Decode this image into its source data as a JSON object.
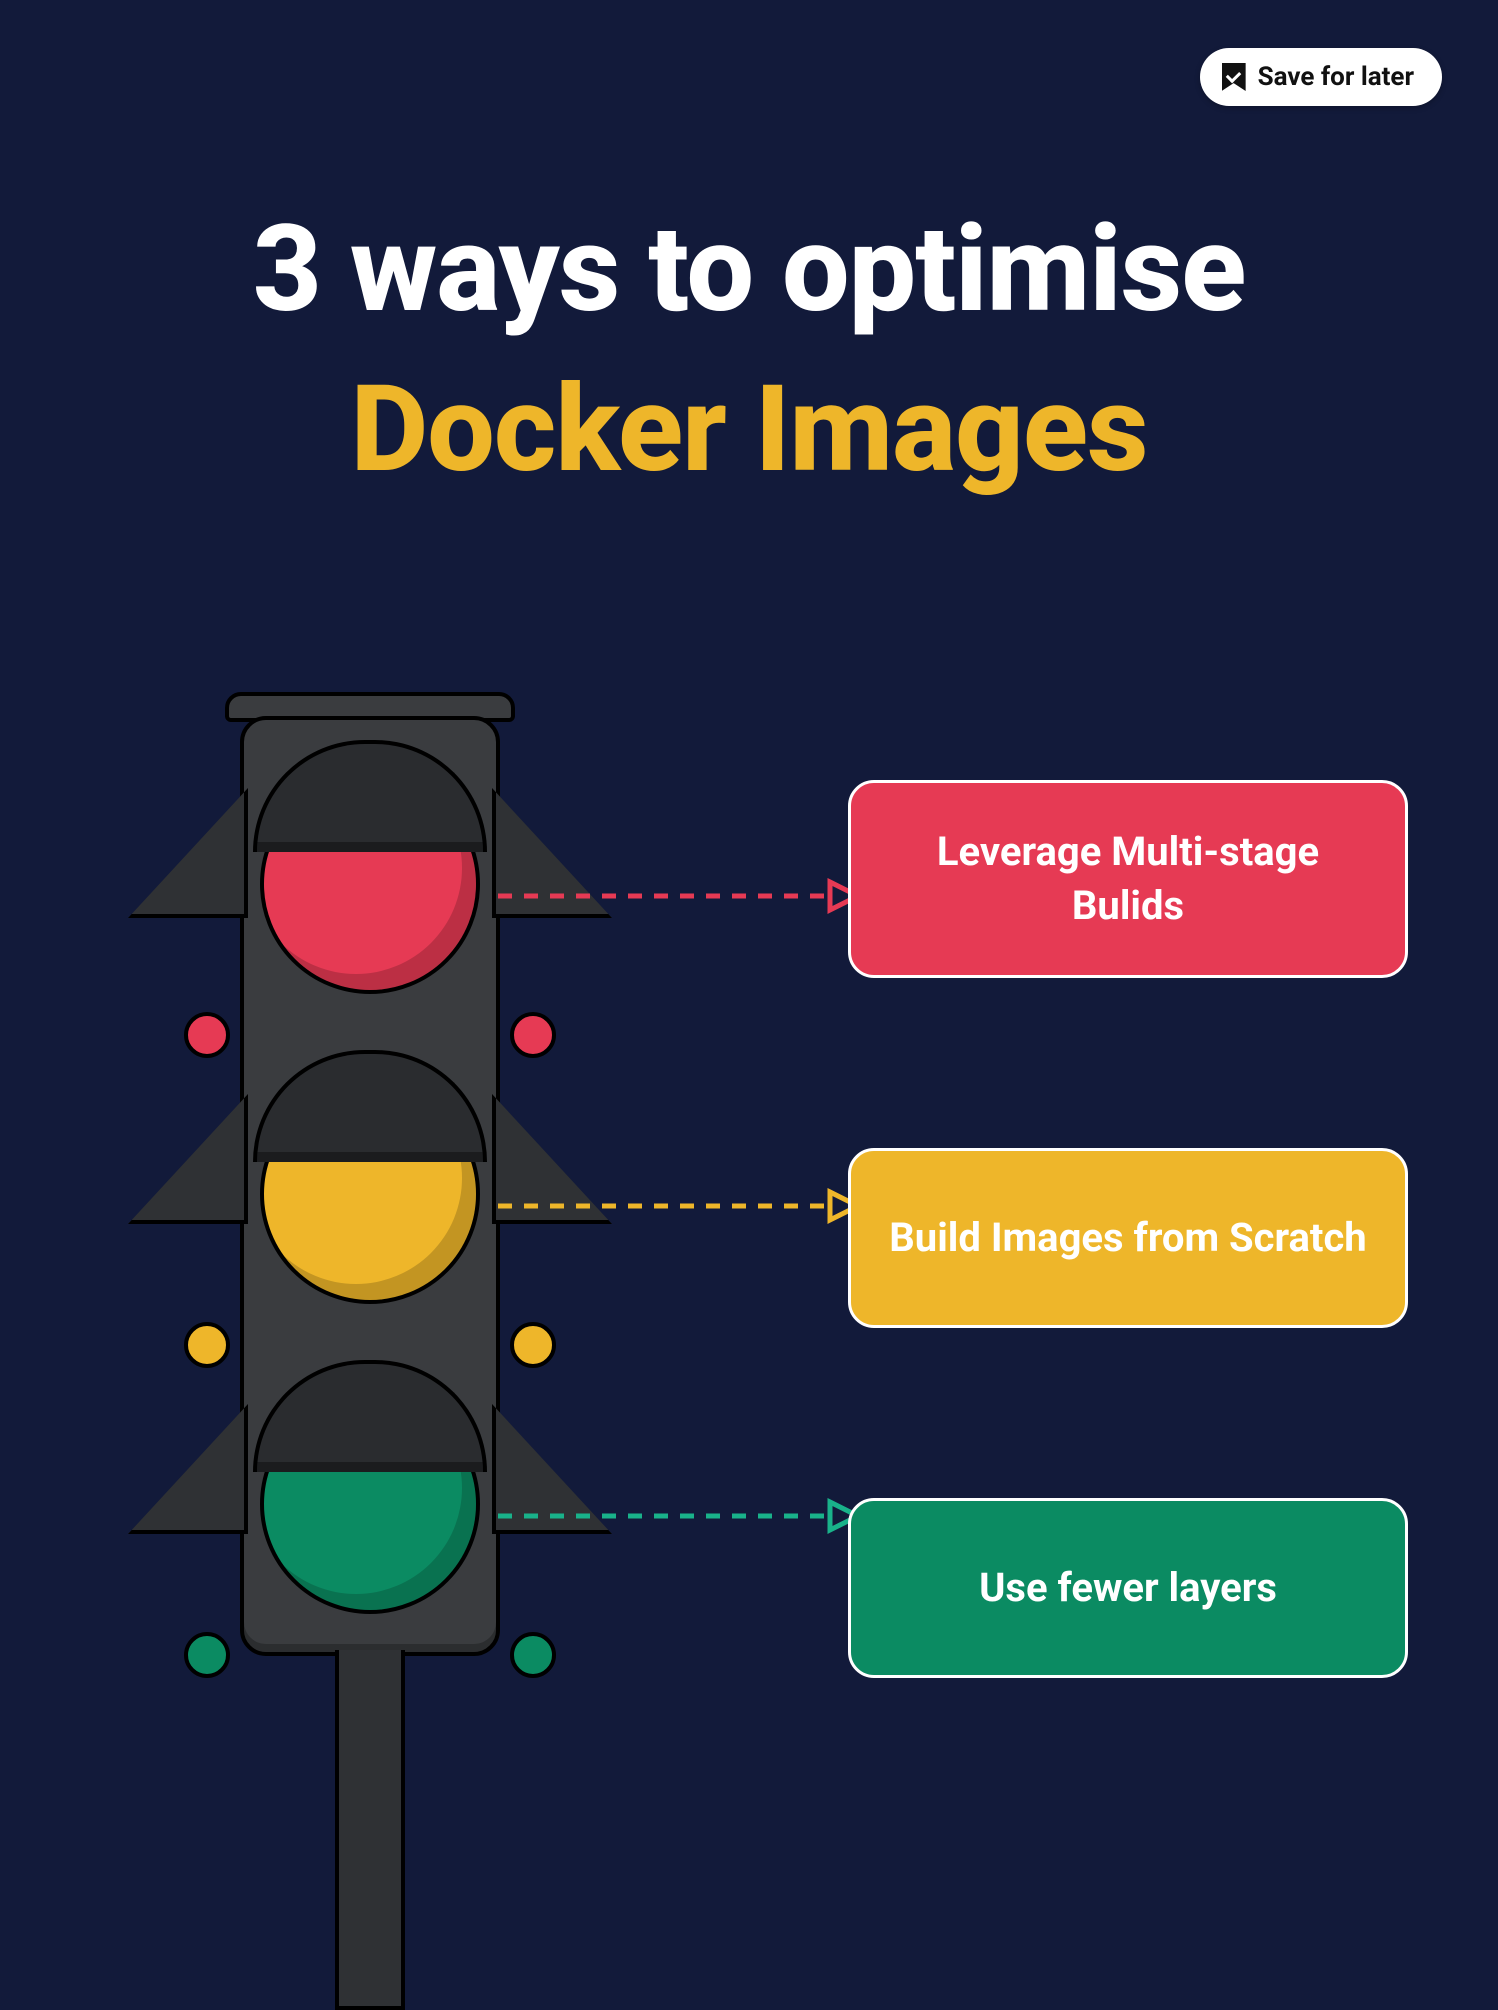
{
  "save_button": {
    "label": "Save for later"
  },
  "title": {
    "line1": "3 ways to optimise",
    "line2": "Docker Images"
  },
  "callouts": {
    "red": {
      "text": "Leverage Multi-stage Bulids"
    },
    "yellow": {
      "text": "Build Images from Scratch"
    },
    "green": {
      "text": "Use fewer layers"
    }
  },
  "colors": {
    "bg": "#121a3a",
    "red": "#e63a54",
    "yellow": "#eeb62a",
    "green": "#0b8b62",
    "white": "#ffffff"
  }
}
